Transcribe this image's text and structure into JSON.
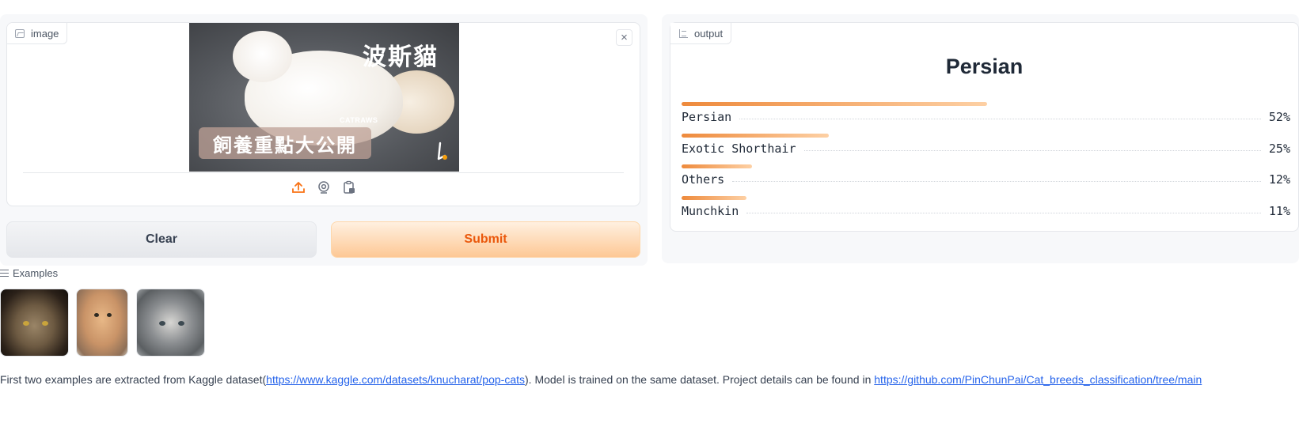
{
  "input": {
    "label": "image",
    "image_caption_title": "波斯貓",
    "image_caption_bottom": "飼養重點大公開",
    "image_logo": "CATRAWS"
  },
  "buttons": {
    "clear": "Clear",
    "submit": "Submit"
  },
  "output": {
    "label": "output",
    "top_label": "Persian",
    "confidences": [
      {
        "label": "Persian",
        "value": "52%",
        "fraction": 0.52
      },
      {
        "label": "Exotic Shorthair",
        "value": "25%",
        "fraction": 0.25
      },
      {
        "label": "Others",
        "value": "12%",
        "fraction": 0.12
      },
      {
        "label": "Munchkin",
        "value": "11%",
        "fraction": 0.11
      }
    ]
  },
  "examples": {
    "label": "Examples"
  },
  "footer": {
    "text1": "First two examples are extracted from Kaggle dataset(",
    "link1": "https://www.kaggle.com/datasets/knucharat/pop-cats",
    "text2": "). Model is trained on the same dataset. Project details can be found in ",
    "link2": "https://github.com/PinChunPai/Cat_breeds_classification/tree/main"
  },
  "colors": {
    "accent": "#ea580c",
    "bar_start": "#ee8a3c",
    "bar_end": "#fdd0a4"
  }
}
